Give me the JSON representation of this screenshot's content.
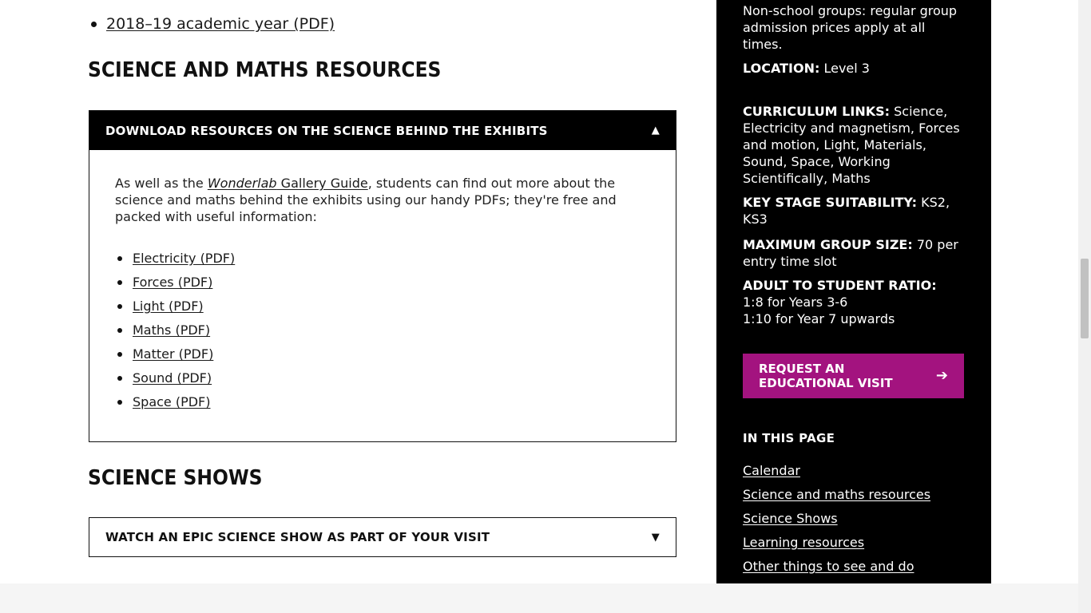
{
  "top_list": {
    "item": "2018–19 academic year (PDF)"
  },
  "sections": {
    "resources_heading": "SCIENCE AND MATHS RESOURCES",
    "shows_heading": "SCIENCE SHOWS"
  },
  "accordion_resources": {
    "title": "DOWNLOAD RESOURCES ON THE SCIENCE BEHIND THE EXHIBITS",
    "caret": "▲",
    "intro_pre": "As well as the ",
    "intro_link_em": "Wonderlab",
    "intro_link_rest": " Gallery Guide",
    "intro_post": ", students can find out more about the science and maths behind the exhibits using our handy PDFs; they're free and packed with useful information:",
    "links": [
      "Electricity (PDF)",
      "Forces (PDF)",
      "Light (PDF)",
      "Maths (PDF)",
      "Matter (PDF)",
      "Sound (PDF)",
      "Space (PDF)"
    ]
  },
  "accordion_shows": {
    "title": "WATCH AN EPIC SCIENCE SHOW AS PART OF YOUR VISIT",
    "caret": "▼"
  },
  "sidebar": {
    "non_school": "Non-school groups: regular group admission prices apply at all times.",
    "location_label": "LOCATION:",
    "location_value": " Level 3",
    "curriculum_label": "CURRICULUM LINKS:",
    "curriculum_value": " Science, Electricity and magnetism, Forces and motion, Light, Materials, Sound, Space, Working Scientifically, Maths",
    "keystage_label": "KEY STAGE SUITABILITY:",
    "keystage_value": " KS2, KS3",
    "groupsize_label": "MAXIMUM GROUP SIZE:",
    "groupsize_value": " 70 per entry time slot",
    "ratio_label": "ADULT TO STUDENT RATIO:",
    "ratio_line1": "1:8 for Years 3-6",
    "ratio_line2": "1:10 for Year 7 upwards",
    "cta_line1": "REQUEST AN",
    "cta_line2": "EDUCATIONAL VISIT",
    "cta_arrow": "➔",
    "in_this_page_title": "IN THIS PAGE",
    "in_this_page": [
      "Calendar",
      "Science and maths resources",
      "Science Shows",
      "Learning resources",
      "Other things to see and do"
    ]
  },
  "colors": {
    "cta_bg": "#a3137f",
    "sidebar_bg": "#000000"
  }
}
